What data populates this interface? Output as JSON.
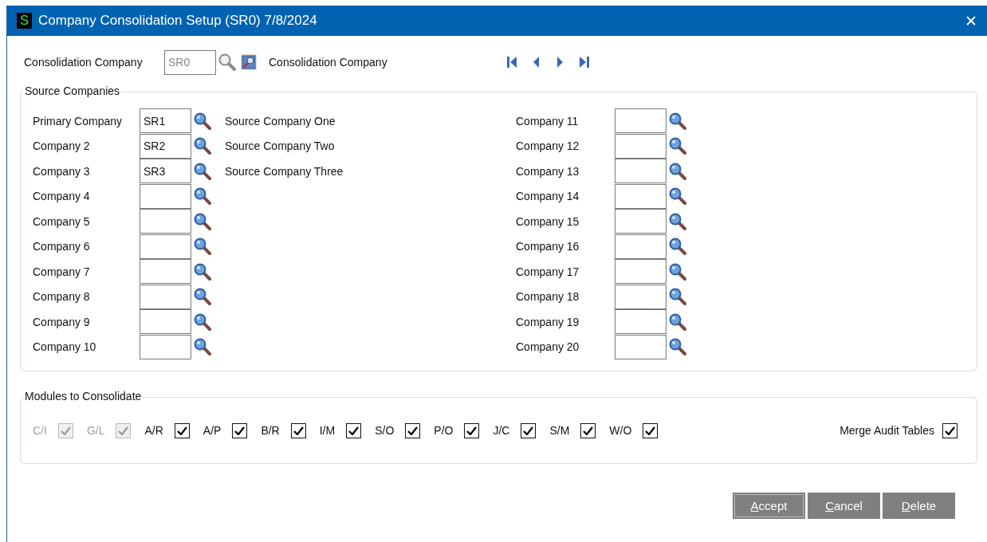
{
  "window": {
    "app_icon": "S",
    "title": "Company Consolidation Setup (SR0) 7/8/2024",
    "close": "✕"
  },
  "header": {
    "label": "Consolidation Company",
    "value": "SR0",
    "description": "Consolidation Company"
  },
  "source_companies": {
    "title": "Source Companies",
    "left": [
      {
        "label": "Primary Company",
        "value": "SR1",
        "description": "Source Company One"
      },
      {
        "label": "Company 2",
        "value": "SR2",
        "description": "Source Company Two"
      },
      {
        "label": "Company 3",
        "value": "SR3",
        "description": "Source Company Three"
      },
      {
        "label": "Company 4"
      },
      {
        "label": "Company 5"
      },
      {
        "label": "Company 6"
      },
      {
        "label": "Company 7"
      },
      {
        "label": "Company 8"
      },
      {
        "label": "Company 9"
      },
      {
        "label": "Company 10"
      }
    ],
    "right": [
      {
        "label": "Company 11"
      },
      {
        "label": "Company 12"
      },
      {
        "label": "Company 13"
      },
      {
        "label": "Company 14"
      },
      {
        "label": "Company 15"
      },
      {
        "label": "Company 16"
      },
      {
        "label": "Company 17"
      },
      {
        "label": "Company 18"
      },
      {
        "label": "Company 19"
      },
      {
        "label": "Company 20"
      }
    ]
  },
  "modules": {
    "title": "Modules to Consolidate",
    "items": [
      {
        "label": "C/I",
        "checked": true,
        "disabled": true
      },
      {
        "label": "G/L",
        "checked": true,
        "disabled": true
      },
      {
        "label": "A/R",
        "checked": true,
        "disabled": false
      },
      {
        "label": "A/P",
        "checked": true,
        "disabled": false
      },
      {
        "label": "B/R",
        "checked": true,
        "disabled": false
      },
      {
        "label": "I/M",
        "checked": true,
        "disabled": false
      },
      {
        "label": "S/O",
        "checked": true,
        "disabled": false
      },
      {
        "label": "P/O",
        "checked": true,
        "disabled": false
      },
      {
        "label": "J/C",
        "checked": true,
        "disabled": false
      },
      {
        "label": "S/M",
        "checked": true,
        "disabled": false
      },
      {
        "label": "W/O",
        "checked": true,
        "disabled": false
      }
    ],
    "merge": {
      "label": "Merge Audit Tables",
      "checked": true
    }
  },
  "buttons": [
    {
      "mnemonic": "A",
      "rest": "ccept",
      "focused": true
    },
    {
      "mnemonic": "C",
      "rest": "ancel",
      "focused": false
    },
    {
      "mnemonic": "D",
      "rest": "elete",
      "focused": false
    }
  ]
}
